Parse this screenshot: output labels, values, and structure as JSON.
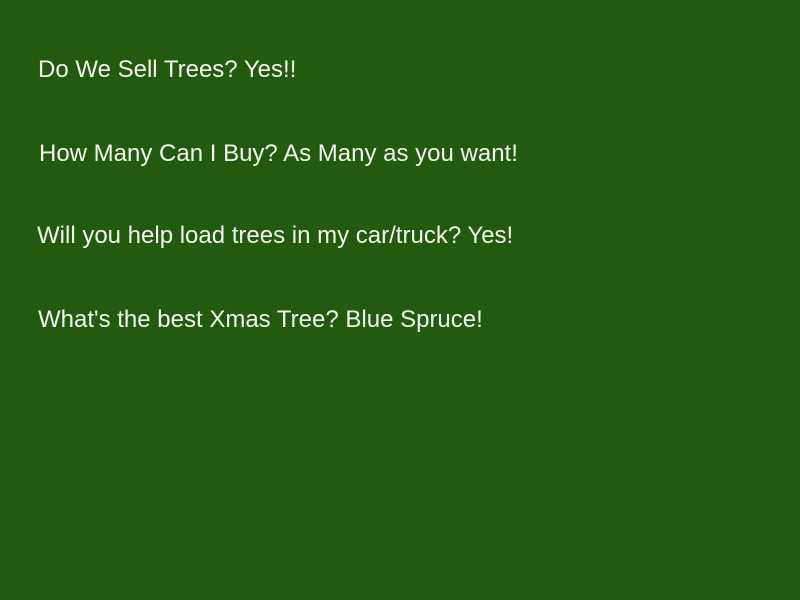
{
  "colors": {
    "background": "#225a0f",
    "text": "#f2f5ee"
  },
  "faq": {
    "items": [
      {
        "text": "Do We Sell Trees? Yes!!"
      },
      {
        "text": "How Many Can I Buy? As Many as you want!"
      },
      {
        "text": "Will you help load trees in my car/truck? Yes!"
      },
      {
        "text": "What's the best Xmas Tree? Blue Spruce!"
      }
    ]
  }
}
